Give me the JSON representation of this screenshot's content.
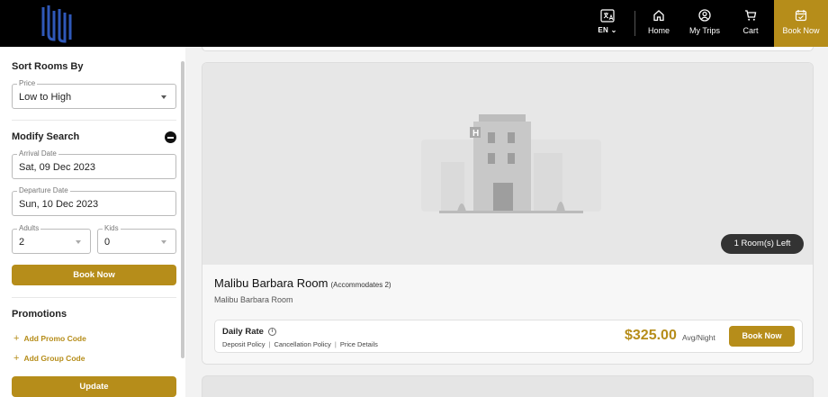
{
  "header": {
    "language": "EN",
    "nav": {
      "home": "Home",
      "my_trips": "My Trips",
      "cart": "Cart",
      "book_now": "Book Now"
    }
  },
  "sidebar": {
    "sort_title": "Sort Rooms By",
    "sort_field": {
      "label": "Price",
      "value": "Low to High"
    },
    "modify_title": "Modify Search",
    "arrival": {
      "label": "Arrival Date",
      "value": "Sat, 09 Dec 2023"
    },
    "departure": {
      "label": "Departure Date",
      "value": "Sun, 10 Dec 2023"
    },
    "adults": {
      "label": "Adults",
      "value": "2"
    },
    "kids": {
      "label": "Kids",
      "value": "0"
    },
    "book_now": "Book Now",
    "promotions_title": "Promotions",
    "add_promo": "Add Promo Code",
    "add_group": "Add Group Code",
    "update": "Update"
  },
  "room": {
    "rooms_left": "1 Room(s) Left",
    "name": "Malibu Barbara Room",
    "accommodates": "(Accommodates 2)",
    "subtitle": "Malibu Barbara Room",
    "rate": {
      "name": "Daily Rate",
      "links": [
        "Deposit Policy",
        "Cancellation Policy",
        "Price Details"
      ],
      "price": "$325.00",
      "per": "Avg/Night",
      "book": "Book Now"
    }
  },
  "colors": {
    "accent": "#b68d1a",
    "header_bg": "#000000"
  }
}
